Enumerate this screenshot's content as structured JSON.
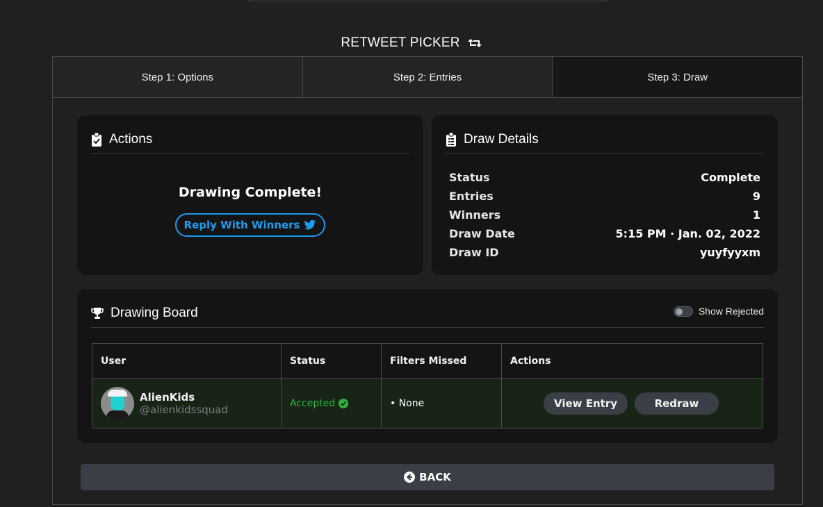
{
  "app": {
    "title": "RETWEET PICKER",
    "icon": "retweet-icon"
  },
  "tabs": [
    {
      "label": "Step 1: Options"
    },
    {
      "label": "Step 2: Entries"
    },
    {
      "label": "Step 3: Draw",
      "active": true
    }
  ],
  "actions_card": {
    "title": "Actions",
    "icon": "clipboard-check-icon",
    "status_text": "Drawing Complete!",
    "reply_button": {
      "label": "Reply With Winners",
      "icon": "twitter-icon"
    }
  },
  "details_card": {
    "title": "Draw Details",
    "icon": "clipboard-list-icon",
    "rows": [
      {
        "label": "Status",
        "value": "Complete"
      },
      {
        "label": "Entries",
        "value": "9"
      },
      {
        "label": "Winners",
        "value": "1"
      },
      {
        "label": "Draw Date",
        "value": "5:15 PM · Jan. 02, 2022"
      },
      {
        "label": "Draw ID",
        "value": "yuyfyyxm"
      }
    ]
  },
  "board_card": {
    "title": "Drawing Board",
    "icon": "trophy-icon",
    "toggle_label": "Show Rejected",
    "toggle_on": false,
    "columns": [
      "User",
      "Status",
      "Filters Missed",
      "Actions"
    ],
    "rows": [
      {
        "name": "AlienKids",
        "handle": "@alienkidssquad",
        "status": "Accepted",
        "filters_missed": "• None",
        "view_label": "View Entry",
        "redraw_label": "Redraw"
      }
    ]
  },
  "back_button": {
    "label": "BACK",
    "icon": "arrow-circle-left-icon"
  },
  "colors": {
    "background": "#202020",
    "card": "#141414",
    "twitter_blue": "#1d9bf0",
    "accepted_green": "#2fb344",
    "button_grey": "#3a3f47"
  }
}
